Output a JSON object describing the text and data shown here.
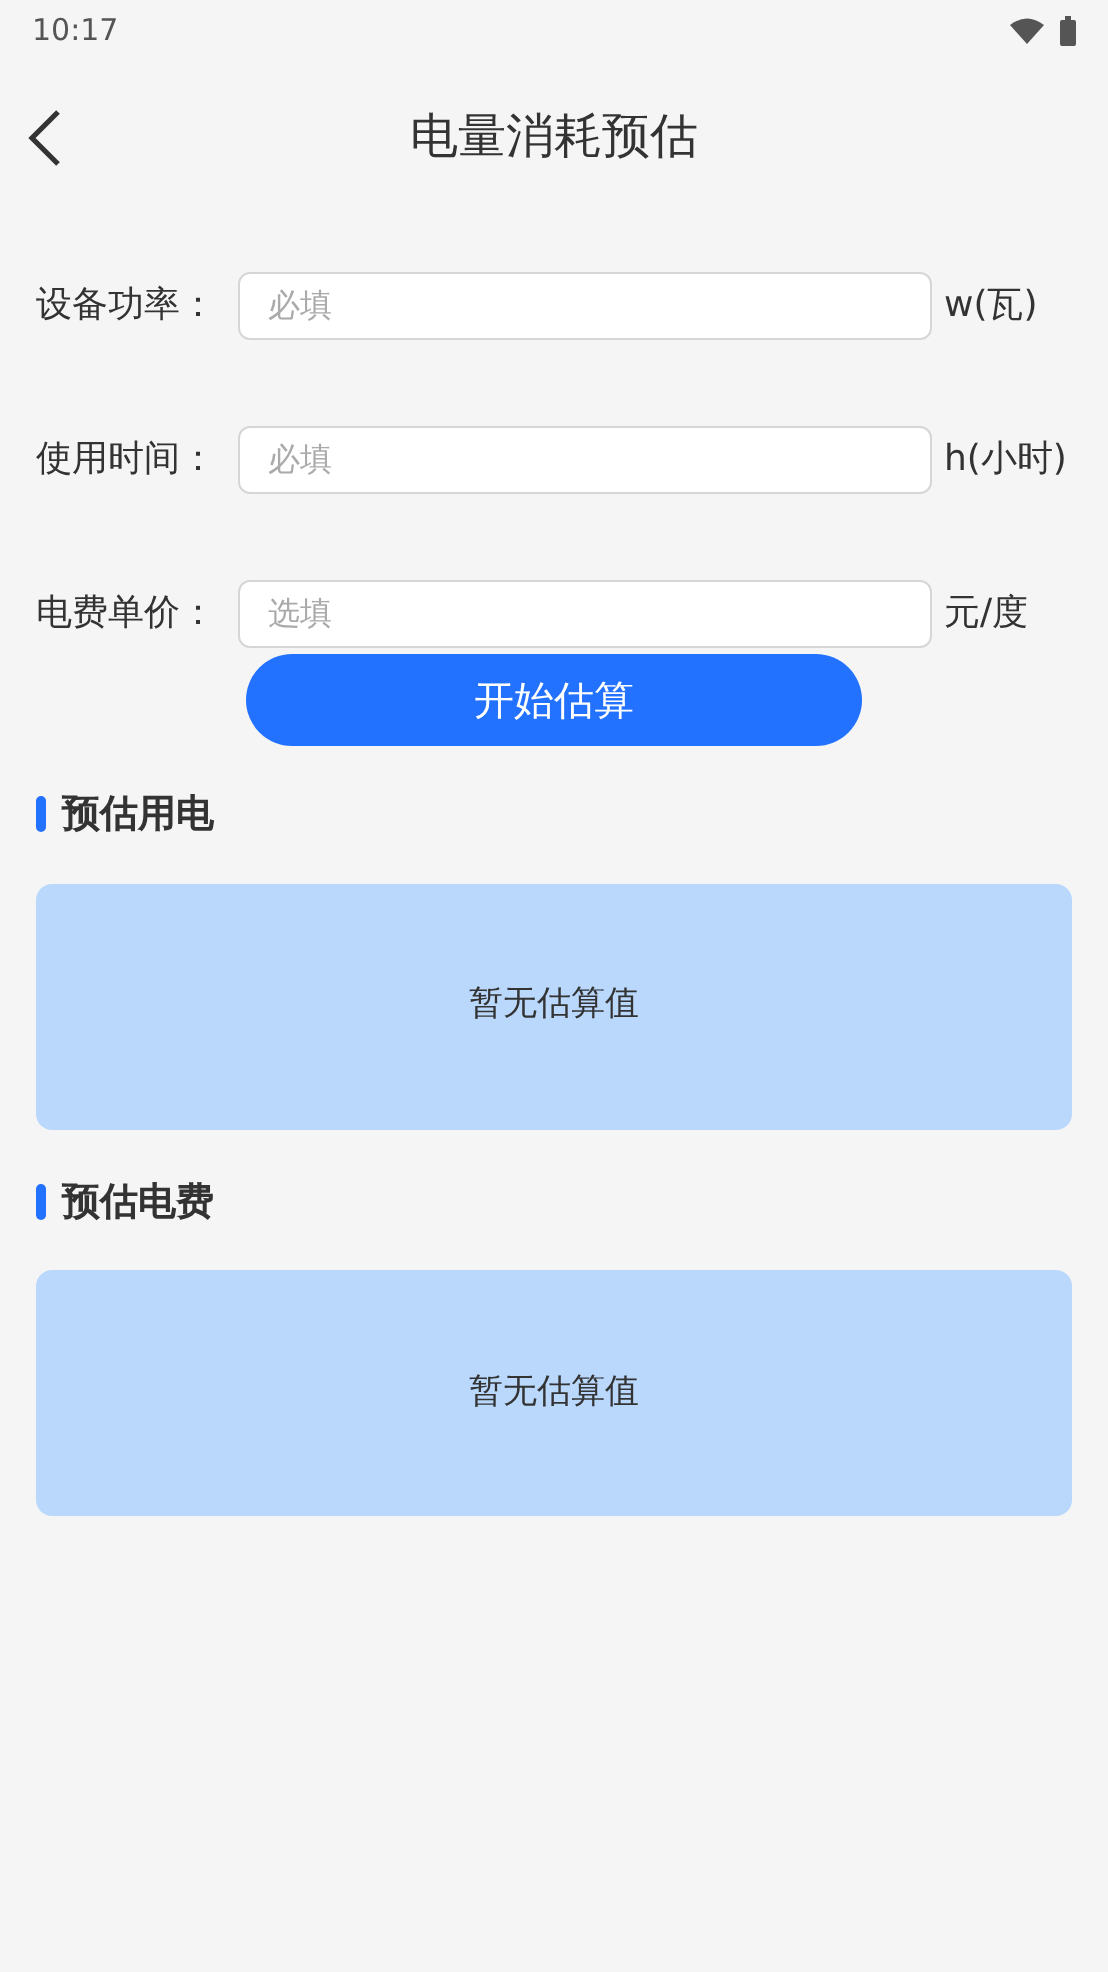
{
  "status_bar": {
    "time": "10:17"
  },
  "header": {
    "title": "电量消耗预估"
  },
  "fields": [
    {
      "label": "设备功率：",
      "placeholder": "必填",
      "unit": "w(瓦)"
    },
    {
      "label": "使用时间：",
      "placeholder": "必填",
      "unit": "h(小时)"
    },
    {
      "label": "电费单价：",
      "placeholder": "选填",
      "unit": "元/度"
    }
  ],
  "button": "开始估算",
  "sections": [
    {
      "title": "预估用电",
      "result": "暂无估算值"
    },
    {
      "title": "预估电费",
      "result": "暂无估算值"
    }
  ]
}
